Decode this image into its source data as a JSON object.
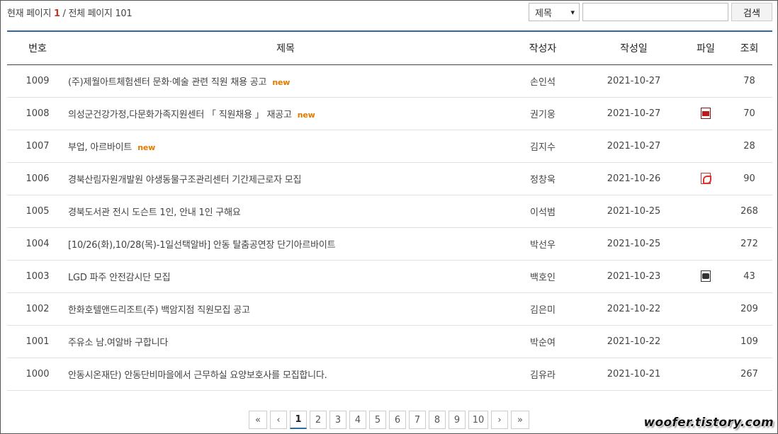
{
  "page_info": {
    "prefix": "현재 페이지 ",
    "current": "1",
    "separator": " / 전체 페이지 ",
    "total": "101"
  },
  "search": {
    "select_value": "제목",
    "input_value": "",
    "button_label": "검색"
  },
  "table": {
    "headers": {
      "no": "번호",
      "title": "제목",
      "author": "작성자",
      "date": "작성일",
      "file": "파일",
      "views": "조회"
    },
    "new_label": "new",
    "rows": [
      {
        "no": "1009",
        "title": "(주)제월아트체험센터 문화·예술 관련 직원 채용 공고",
        "new": true,
        "author": "손인석",
        "date": "2021-10-27",
        "file": "",
        "views": "78"
      },
      {
        "no": "1008",
        "title": "의성군건강가정,다문화가족지원센터 「 직원채용 」 재공고",
        "new": true,
        "author": "권기웅",
        "date": "2021-10-27",
        "file": "hwp-file-icon",
        "views": "70"
      },
      {
        "no": "1007",
        "title": "부업, 아르바이트",
        "new": true,
        "author": "김지수",
        "date": "2021-10-27",
        "file": "",
        "views": "28"
      },
      {
        "no": "1006",
        "title": "경북산림자원개발원 야생동물구조관리센터 기간제근로자 모집",
        "new": false,
        "author": "정창욱",
        "date": "2021-10-26",
        "file": "pdf-file-icon",
        "views": "90"
      },
      {
        "no": "1005",
        "title": "경북도서관 전시 도슨트 1인, 안내 1인 구해요",
        "new": false,
        "author": "이석범",
        "date": "2021-10-25",
        "file": "",
        "views": "268"
      },
      {
        "no": "1004",
        "title": "[10/26(화),10/28(목)-1일선택알바] 안동 탈춤공연장 단기아르바이트",
        "new": false,
        "author": "박선우",
        "date": "2021-10-25",
        "file": "",
        "views": "272"
      },
      {
        "no": "1003",
        "title": "LGD 파주 안전감시단 모집",
        "new": false,
        "author": "백호인",
        "date": "2021-10-23",
        "file": "jpg-file-icon",
        "views": "43"
      },
      {
        "no": "1002",
        "title": "한화호텔앤드리조트(주) 백암지점 직원모집 공고",
        "new": false,
        "author": "김은미",
        "date": "2021-10-22",
        "file": "",
        "views": "209"
      },
      {
        "no": "1001",
        "title": "주유소 남.여알바 구합니다",
        "new": false,
        "author": "박순여",
        "date": "2021-10-22",
        "file": "",
        "views": "109"
      },
      {
        "no": "1000",
        "title": "안동시온재단) 안동단비마을에서 근무하실 요양보호사를 모집합니다.",
        "new": false,
        "author": "김유라",
        "date": "2021-10-21",
        "file": "",
        "views": "267"
      }
    ]
  },
  "pagination": {
    "first": "«",
    "prev": "‹",
    "pages": [
      "1",
      "2",
      "3",
      "4",
      "5",
      "6",
      "7",
      "8",
      "9",
      "10"
    ],
    "active": "1",
    "next": "›",
    "last": "»"
  },
  "watermark": "woofer.tistory.com",
  "colors": {
    "accent": "#2c6aa0",
    "current_page": "#c0392b",
    "new_badge": "#e07b00"
  }
}
